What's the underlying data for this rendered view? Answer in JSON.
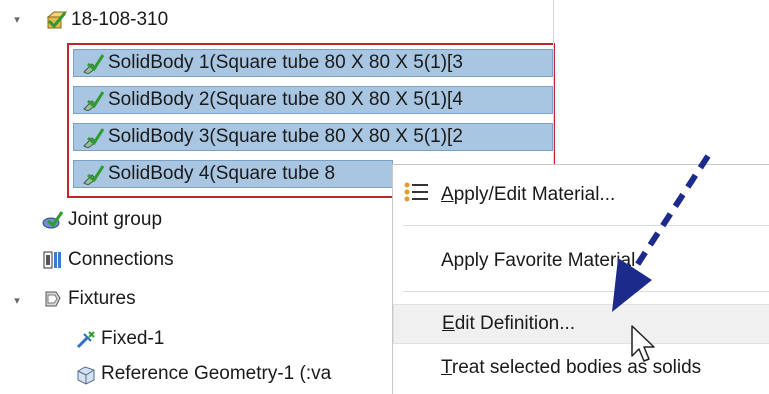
{
  "tree": {
    "root": {
      "label": "18-108-310",
      "twisty": "▾"
    },
    "bodies": [
      {
        "label": "SolidBody 1(Square tube 80 X 80 X 5(1)[3"
      },
      {
        "label": "SolidBody 2(Square tube 80 X 80 X 5(1)[4"
      },
      {
        "label": "SolidBody 3(Square tube 80 X 80 X 5(1)[2"
      },
      {
        "label": "SolidBody 4(Square tube 8"
      }
    ],
    "joint_group": "Joint group",
    "connections": "Connections",
    "fixtures": {
      "label": "Fixtures",
      "twisty": "▾"
    },
    "fixed": "Fixed-1",
    "reference_geometry": "Reference Geometry-1 (:va"
  },
  "context_menu": {
    "apply_edit_material": {
      "key": "A",
      "rest": "pply/Edit Material..."
    },
    "apply_favorite_material": "Apply Favorite Material",
    "edit_definition": {
      "key": "E",
      "rest": "dit Definition..."
    },
    "treat_as_solids": {
      "key": "T",
      "rest": "reat selected bodies as solids"
    }
  },
  "colors": {
    "selection": "#a8c6e2",
    "highlight_box": "#c0262c",
    "arrow": "#1c2a8c"
  },
  "icons": [
    "part-checked-icon",
    "solid-body-icon",
    "joint-group-icon",
    "connections-icon",
    "fixtures-icon",
    "fixed-icon",
    "reference-geometry-icon",
    "material-list-icon",
    "pointer-cursor-icon",
    "annotation-arrow-icon"
  ]
}
